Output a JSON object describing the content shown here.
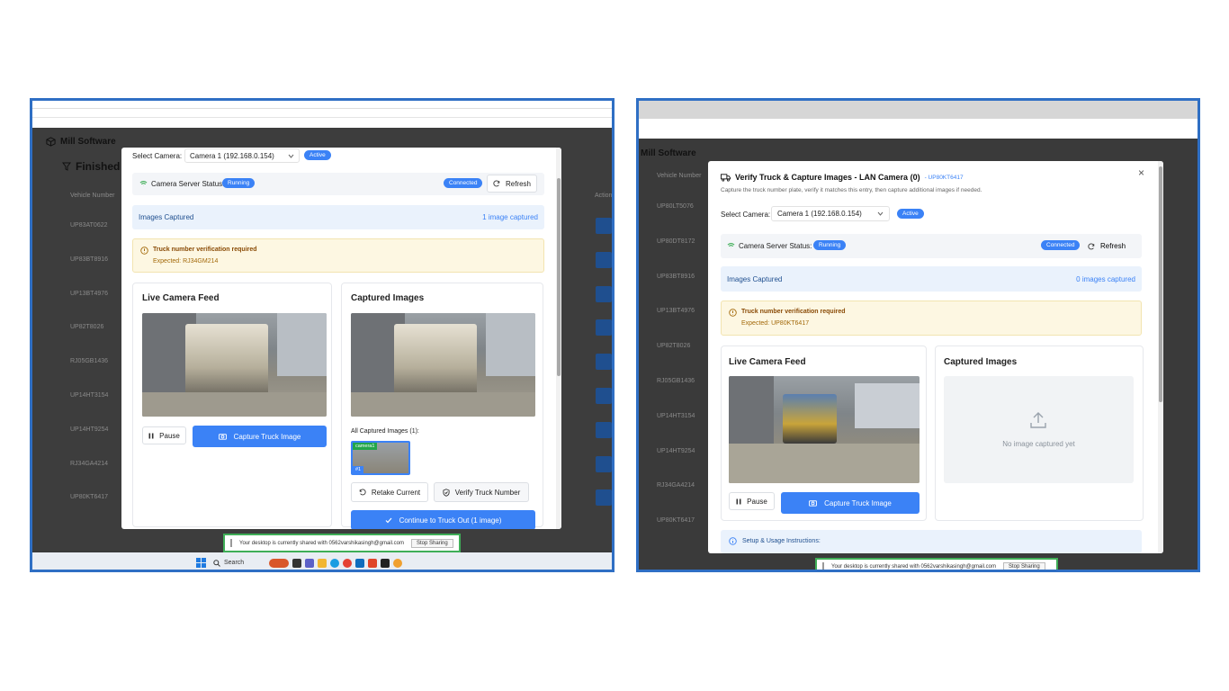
{
  "left": {
    "app_title": "Mill Software",
    "section_title": "Finished",
    "col_vehicle": "Vehicle Number",
    "col_action": "Action",
    "vehicle_numbers": [
      "UP83AT0622",
      "UP83BT8916",
      "UP13BT4976",
      "UP82T8026",
      "RJ05GB1436",
      "UP14HT3154",
      "UP14HT9254",
      "RJ34GA4214",
      "UP80KT6417"
    ],
    "modal": {
      "select_label": "Select Camera:",
      "camera_value": "Camera 1 (192.168.0.154)",
      "active_badge": "Active",
      "server_status_label": "Camera Server Status:",
      "running_badge": "Running",
      "connected_badge": "Connected",
      "refresh_label": "Refresh",
      "images_captured_label": "Images Captured",
      "images_captured_count": "1 image captured",
      "verify_title": "Truck number verification required",
      "verify_expected": "Expected: RJ34GM214",
      "live_feed_title": "Live Camera Feed",
      "captured_title": "Captured Images",
      "pause_label": "Pause",
      "capture_label": "Capture Truck Image",
      "all_captured_label": "All Captured Images (1):",
      "thumb_tag": "camera1",
      "thumb_num": "#1",
      "retake_label": "Retake Current",
      "verify_label": "Verify Truck Number",
      "continue_label": "Continue to Truck Out (1 image)"
    },
    "share_text": "Your desktop is currently shared with 0562varshikasingh@gmail.com",
    "stop_sharing": "Stop Sharing",
    "search_label": "Search"
  },
  "right": {
    "app_title": "Mill Software",
    "col_vehicle": "Vehicle Number",
    "vehicle_numbers": [
      "UP80LT5076",
      "UP80DT8172",
      "UP83BT8916",
      "UP13BT4976",
      "UP82T8026",
      "RJ05GB1436",
      "UP14HT3154",
      "UP14HT9254",
      "RJ34GA4214",
      "UP80KT6417"
    ],
    "modal": {
      "title": "Verify Truck & Capture Images - LAN Camera (0)",
      "title_suffix": "- UP80KT6417",
      "subtitle": "Capture the truck number plate, verify it matches this entry, then capture additional images if needed.",
      "close_label": "×",
      "select_label": "Select Camera:",
      "camera_value": "Camera 1 (192.168.0.154)",
      "active_badge": "Active",
      "server_status_label": "Camera Server Status:",
      "running_badge": "Running",
      "connected_badge": "Connected",
      "refresh_label": "Refresh",
      "images_captured_label": "Images Captured",
      "images_captured_count": "0 images captured",
      "verify_title": "Truck number verification required",
      "verify_expected": "Expected: UP80KT6417",
      "live_feed_title": "Live Camera Feed",
      "captured_title": "Captured Images",
      "no_image_text": "No image captured yet",
      "pause_label": "Pause",
      "capture_label": "Capture Truck Image",
      "instructions_label": "Setup & Usage Instructions:"
    },
    "share_text": "Your desktop is currently shared with 0562varshikasingh@gmail.com",
    "stop_sharing": "Stop Sharing"
  },
  "colors": {
    "frame_border": "#2f6fc4",
    "primary": "#3b82f6",
    "warning_bg": "#fdf7e2",
    "info_bg": "#eaf2fc",
    "share_border": "#3fae57"
  }
}
